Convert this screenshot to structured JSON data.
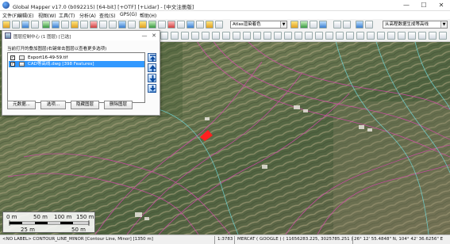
{
  "window": {
    "title": "Global Mapper v17.0 (b092215) [64-bit] [+OTF] [+Lidar] - [中文注册版]",
    "minimize": "—",
    "maximize": "☐",
    "close": "✕"
  },
  "menu": [
    "文件(F)",
    "编辑(E)",
    "视图(W)",
    "工具(T)",
    "分析(A)",
    "查找(S)",
    "GPS(G)",
    "帮助(H)"
  ],
  "toolbar": {
    "shader_combo": "Atlas渲染着色",
    "search_combo": "从高程数据生成等高线"
  },
  "dialog": {
    "title": "图层控制中心 (1 图层) [已选]",
    "close": "✕",
    "description": "当前打开的叠加图层(右键单击图层以查看更多选项)",
    "layers": [
      {
        "name": "Export16-49-59.tif",
        "checked": true,
        "selected": false
      },
      {
        "name": "CAD等高线.dwg [398 Features]",
        "checked": true,
        "selected": true
      }
    ],
    "buttons": {
      "metadata": "元数据...",
      "options": "选项...",
      "hide_layer": "隐藏图层",
      "delete_layer": "删除图层"
    }
  },
  "scalebar": {
    "labels": [
      "0 m",
      "50 m",
      "100 m",
      "150 m"
    ],
    "bottom_labels": [
      "25 m",
      "50 m"
    ]
  },
  "status": {
    "feature": "<NO LABEL> CONTOUR_LINE_MINOR [Contour Line, Minor] [1350 m]",
    "scale": "1:3783",
    "projection": "MERCAT ( GOOGLE ) ( 11656283.225, 3025785.251 )",
    "coords": "26° 12' 55.4848\" N, 104° 42' 36.6256\" E"
  },
  "colors": {
    "selection": "#3399ff",
    "contour_minor": "#d04aa8",
    "contour_cyan": "#6fd6d6",
    "red_marker": "#ff2020"
  }
}
